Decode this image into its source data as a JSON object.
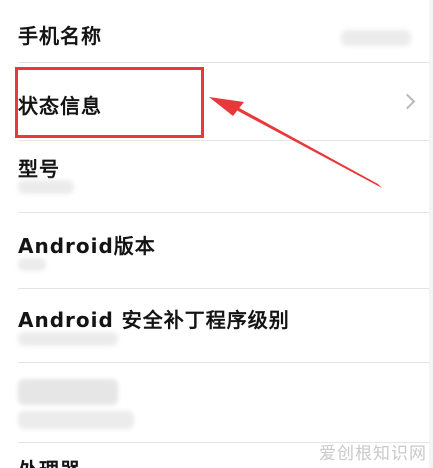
{
  "settings": {
    "rows": [
      {
        "label": "手机名称"
      },
      {
        "label": "状态信息"
      },
      {
        "label": "型号"
      },
      {
        "label": "Android版本"
      },
      {
        "label": "Android 安全补丁程序级别"
      },
      {
        "label": ""
      },
      {
        "label": "处理器"
      }
    ]
  },
  "annotation": {
    "box_color": "#e8383b",
    "arrow_color": "#e8383b"
  },
  "watermark": {
    "text": "爱创根知识网"
  },
  "icons": {
    "status_chevron": "chevron-right-icon"
  }
}
